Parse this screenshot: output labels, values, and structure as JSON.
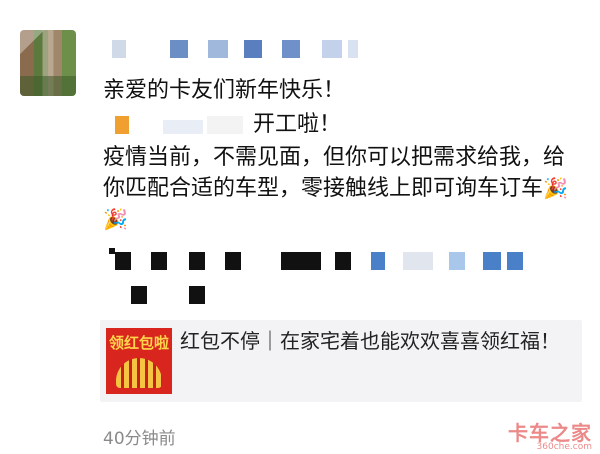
{
  "post": {
    "greeting": "亲爱的卡友们新年快乐！",
    "line2_suffix": "开工啦！",
    "body": "疫情当前，不需见面，但你可以把需求给我，给你匹配合适的车型，零接触线上即可询车订车",
    "party_emoji": "🎉🎉"
  },
  "card": {
    "thumb_text": "领红包啦",
    "title": "红包不停｜在家宅着也能欢欢喜喜领红福！"
  },
  "timestamp": "40分钟前",
  "watermark": {
    "text": "卡车之家",
    "sub": "360che.com"
  },
  "colors": {
    "mask_dark": "#111111",
    "mask_blue": "#4a80c8",
    "mask_light_blue": "#a9c7ea",
    "card_bg": "#f3f3f5",
    "red": "#d8261f"
  }
}
